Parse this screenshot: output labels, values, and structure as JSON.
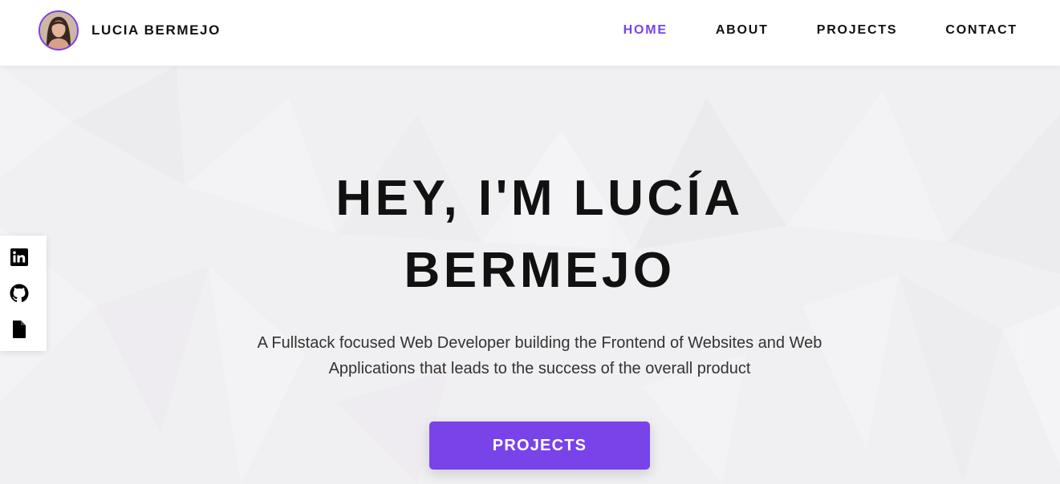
{
  "header": {
    "brand_name": "LUCIA BERMEJO",
    "avatar_icon": "profile-photo",
    "nav": [
      {
        "label": "HOME",
        "active": true
      },
      {
        "label": "ABOUT",
        "active": false
      },
      {
        "label": "PROJECTS",
        "active": false
      },
      {
        "label": "CONTACT",
        "active": false
      }
    ]
  },
  "hero": {
    "title_line1": "HEY, I'M LUCÍA",
    "title_line2": "BERMEJO",
    "subtitle": "A Fullstack focused Web Developer building the Frontend of Websites and Web Applications that leads to the success of the overall product",
    "cta_label": "PROJECTS"
  },
  "social": [
    {
      "icon": "linkedin-icon"
    },
    {
      "icon": "github-icon"
    },
    {
      "icon": "file-icon"
    }
  ],
  "colors": {
    "accent": "#7843e9",
    "text": "#111111",
    "hero_bg": "#f0eff1"
  }
}
